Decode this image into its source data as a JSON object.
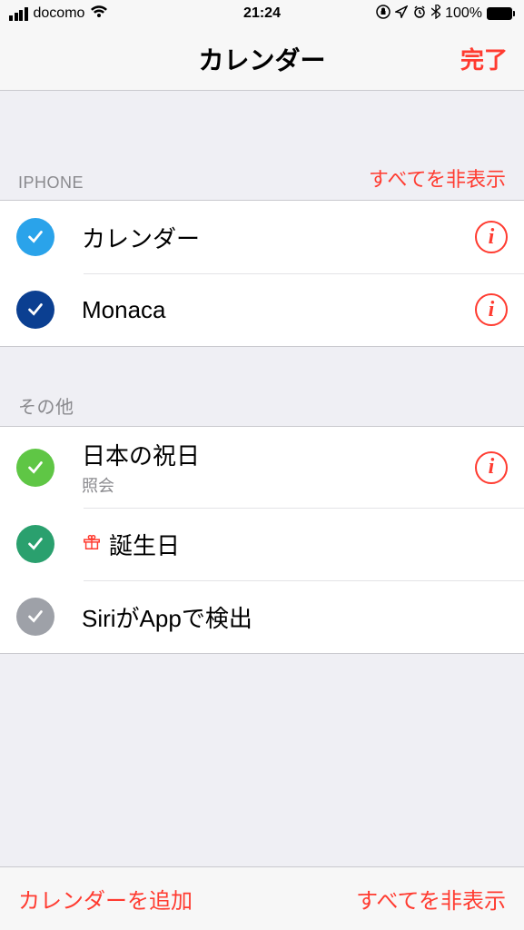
{
  "status": {
    "carrier": "docomo",
    "time": "21:24",
    "battery": "100%"
  },
  "nav": {
    "title": "カレンダー",
    "done": "完了"
  },
  "sections": [
    {
      "header": "IPHONE",
      "header_upper": true,
      "action": "すべてを非表示",
      "items": [
        {
          "title": "カレンダー",
          "checkColor": "#2aa3ea",
          "hasInfo": true
        },
        {
          "title": "Monaca",
          "checkColor": "#0b3f91",
          "hasInfo": true
        }
      ]
    },
    {
      "header": "その他",
      "header_upper": false,
      "items": [
        {
          "title": "日本の祝日",
          "sub": "照会",
          "checkColor": "#5fc645",
          "hasInfo": true
        },
        {
          "title": "誕生日",
          "checkColor": "#2aa06e",
          "giftIcon": true
        },
        {
          "title": "SiriがAppで検出",
          "checkColor": "#9ea1a8"
        }
      ]
    }
  ],
  "toolbar": {
    "add": "カレンダーを追加",
    "hideAll": "すべてを非表示"
  }
}
